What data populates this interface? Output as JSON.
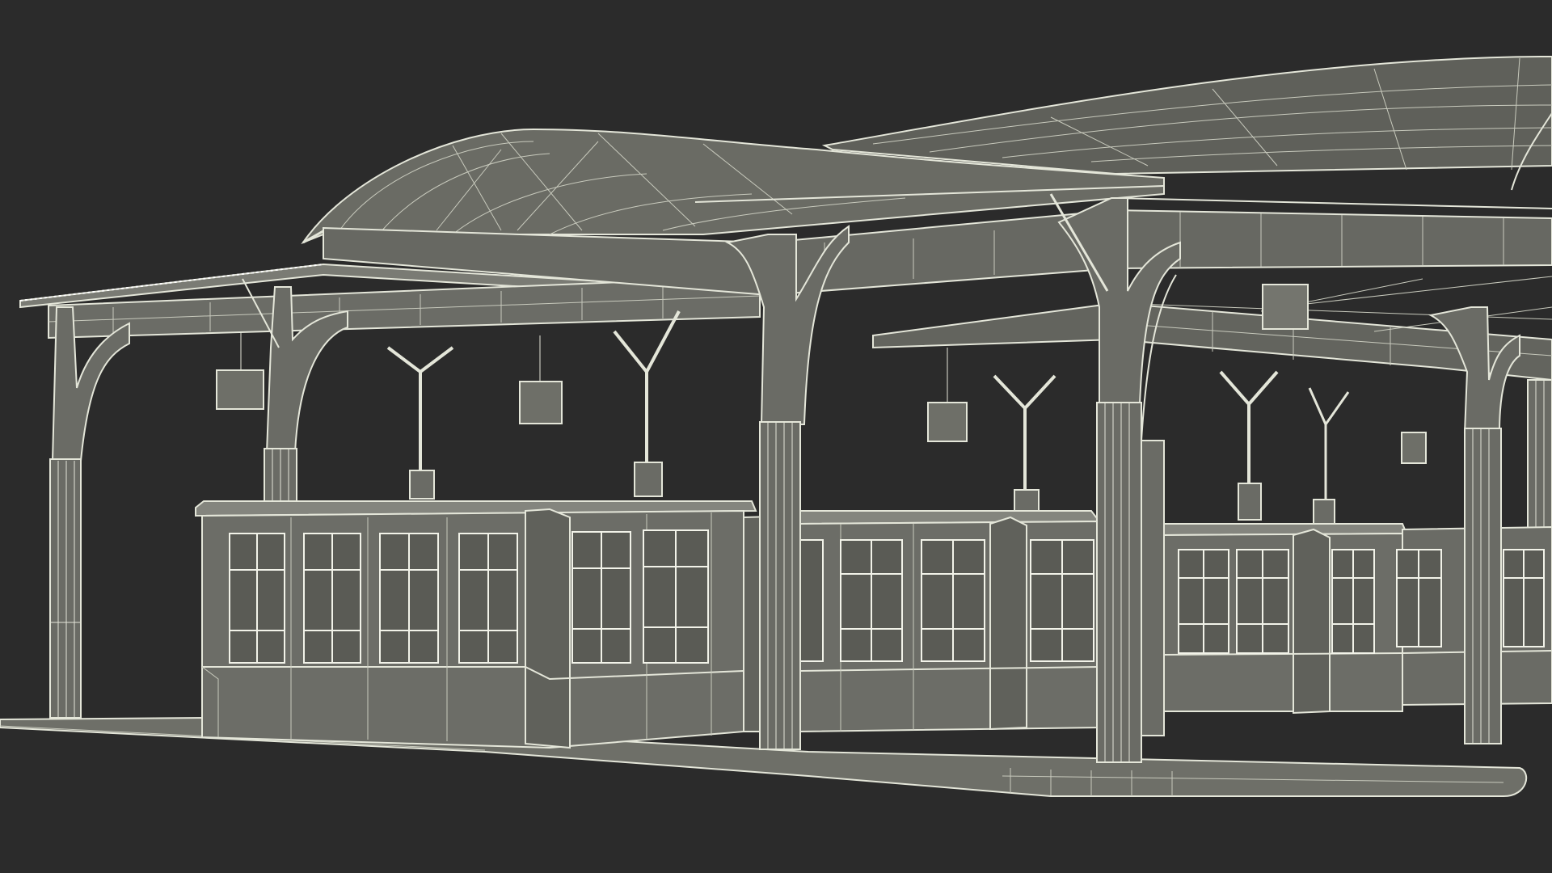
{
  "scene": {
    "background": "#2b2b2b",
    "surface": "#6e6f68",
    "surface_dark": "#5c5d57",
    "surface_light": "#7c7d76",
    "wire": "#e4e6d9",
    "wire_dim": "#b9bbae"
  }
}
